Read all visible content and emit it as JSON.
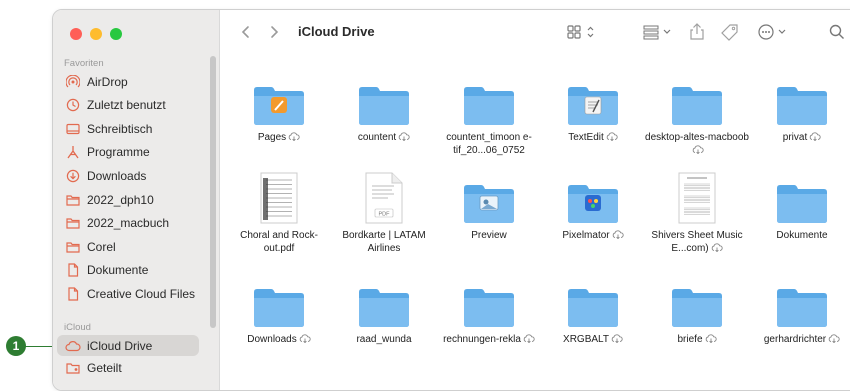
{
  "window": {
    "title": "iCloud Drive"
  },
  "sidebar": {
    "favorites_heading": "Favoriten",
    "favorites": [
      {
        "label": "AirDrop",
        "icon": "airdrop-icon"
      },
      {
        "label": "Zuletzt benutzt",
        "icon": "clock-icon"
      },
      {
        "label": "Schreibtisch",
        "icon": "desktop-icon"
      },
      {
        "label": "Programme",
        "icon": "apps-icon"
      },
      {
        "label": "Downloads",
        "icon": "download-icon"
      },
      {
        "label": "2022_dph10",
        "icon": "folder-icon"
      },
      {
        "label": "2022_macbuch",
        "icon": "folder-icon"
      },
      {
        "label": "Corel",
        "icon": "folder-icon"
      },
      {
        "label": "Dokumente",
        "icon": "document-icon"
      },
      {
        "label": "Creative Cloud Files",
        "icon": "document-icon"
      }
    ],
    "icloud_heading": "iCloud",
    "icloud": [
      {
        "label": "iCloud Drive",
        "icon": "cloud-icon",
        "selected": true
      },
      {
        "label": "Geteilt",
        "icon": "shared-folder-icon"
      }
    ]
  },
  "callout": {
    "number": "1"
  },
  "accent_color": "#e26a4f",
  "folder_color": "#5aa9e6",
  "items": [
    {
      "label": "Pages",
      "type": "app-folder",
      "badge": "pages",
      "cloud": true
    },
    {
      "label": "countent",
      "type": "folder",
      "cloud": true
    },
    {
      "label": "countent_timoon e-tif_20...06_0752",
      "type": "folder",
      "cloud": false
    },
    {
      "label": "TextEdit",
      "type": "app-folder",
      "badge": "textedit",
      "cloud": true
    },
    {
      "label": "desktop-altes-macboob",
      "type": "folder",
      "cloud": true
    },
    {
      "label": "privat",
      "type": "folder",
      "cloud": true
    },
    {
      "label": "Choral and Rock-out.pdf",
      "type": "pdf-sheet",
      "cloud": false
    },
    {
      "label": "Bordkarte | LATAM Airlines",
      "type": "pdf",
      "cloud": false
    },
    {
      "label": "Preview",
      "type": "app-folder",
      "badge": "preview",
      "cloud": false
    },
    {
      "label": "Pixelmator",
      "type": "app-folder",
      "badge": "pixelmator",
      "cloud": true
    },
    {
      "label": "Shivers Sheet Music E...com)",
      "type": "sheet",
      "cloud": true
    },
    {
      "label": "Dokumente",
      "type": "folder",
      "cloud": false
    },
    {
      "label": "Downloads",
      "type": "folder",
      "cloud": true
    },
    {
      "label": "raad_wunda",
      "type": "folder",
      "cloud": false
    },
    {
      "label": "rechnungen-rekla",
      "type": "folder",
      "cloud": true
    },
    {
      "label": "XRGBALT",
      "type": "folder",
      "cloud": true
    },
    {
      "label": "briefe",
      "type": "folder",
      "cloud": true
    },
    {
      "label": "gerhardrichter",
      "type": "folder",
      "cloud": true
    }
  ]
}
